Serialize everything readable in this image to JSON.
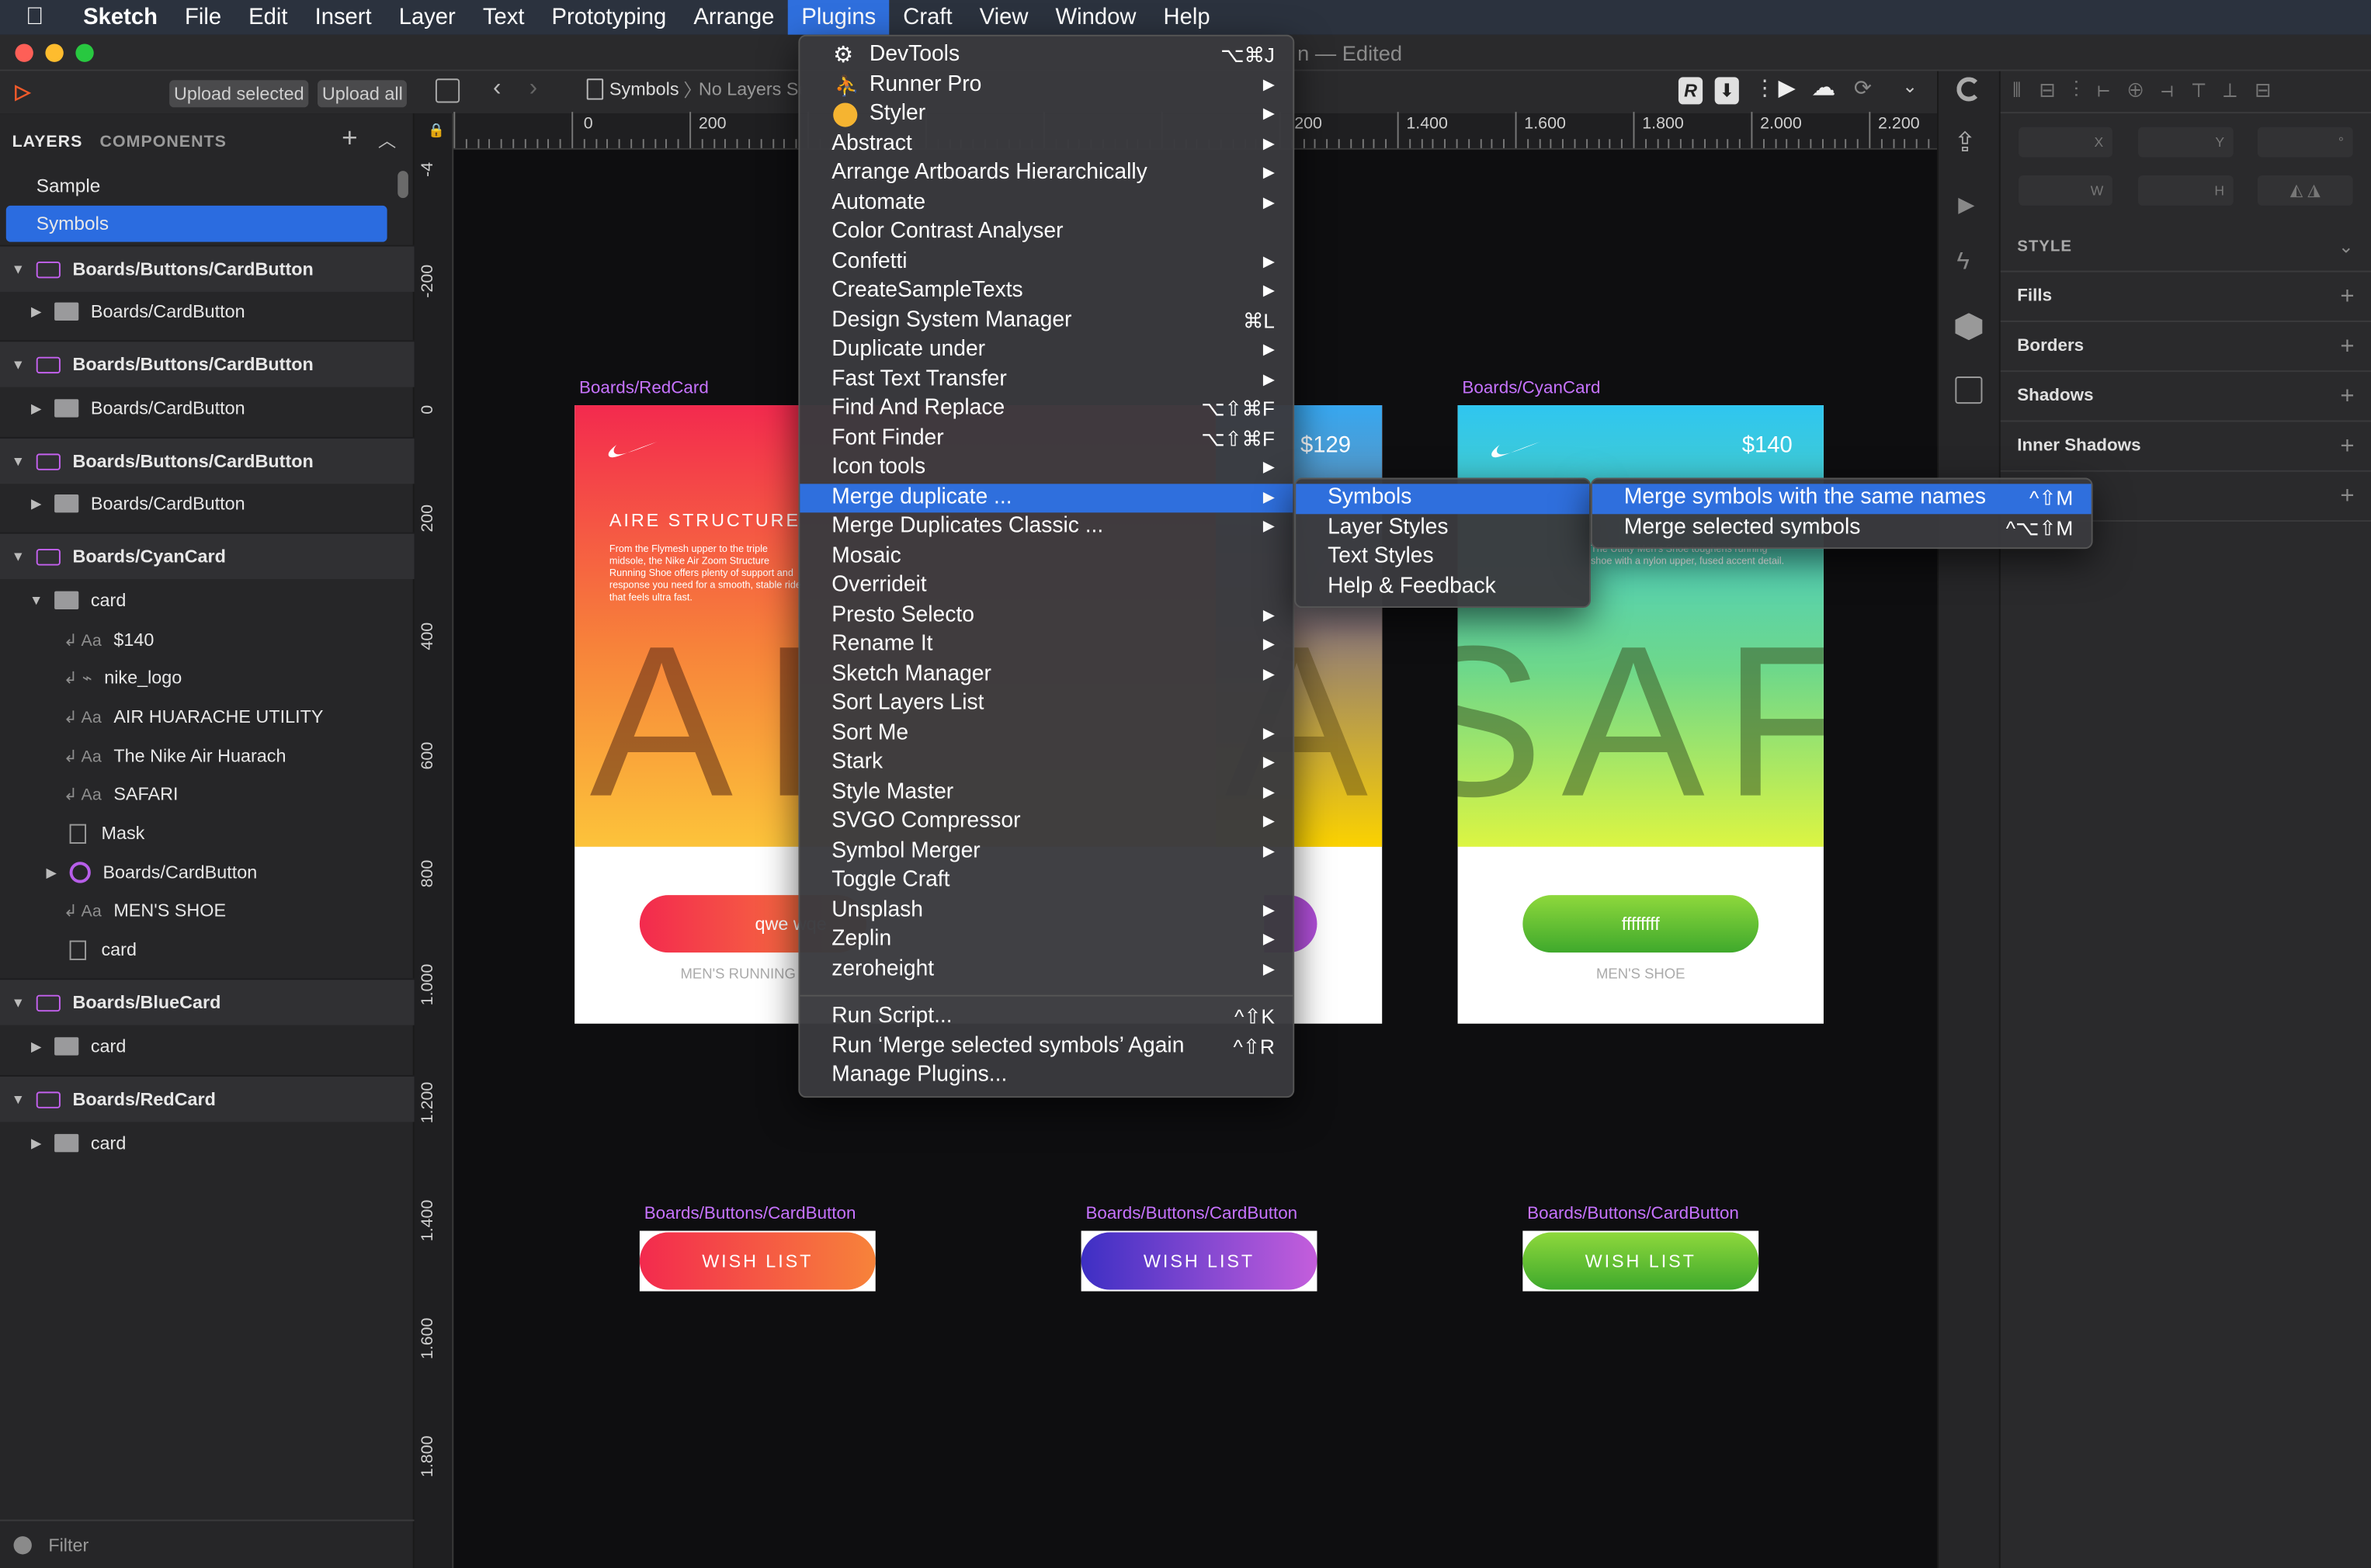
{
  "menubar": {
    "items": [
      "Sketch",
      "File",
      "Edit",
      "Insert",
      "Layer",
      "Text",
      "Prototyping",
      "Arrange",
      "Plugins",
      "Craft",
      "View",
      "Window",
      "Help"
    ],
    "active": "Plugins"
  },
  "window": {
    "title_suffix": "n — Edited"
  },
  "toolbar": {
    "upload_selected": "Upload selected",
    "upload_all": "Upload all",
    "breadcrumb_page": "Symbols",
    "breadcrumb_layers": "No Layers Se"
  },
  "left_panel": {
    "tab_layers": "LAYERS",
    "tab_components": "COMPONENTS",
    "pages": [
      "Sample",
      "Symbols"
    ],
    "layers": [
      {
        "label": "Boards/Buttons/CardButton",
        "kind": "board"
      },
      {
        "label": "Boards/CardButton",
        "kind": "folder"
      },
      {
        "label": "Boards/Buttons/CardButton",
        "kind": "board"
      },
      {
        "label": "Boards/CardButton",
        "kind": "folder"
      },
      {
        "label": "Boards/Buttons/CardButton",
        "kind": "board"
      },
      {
        "label": "Boards/CardButton",
        "kind": "folder"
      },
      {
        "label": "Boards/CyanCard",
        "kind": "board"
      },
      {
        "label": "card",
        "kind": "folder-open"
      },
      {
        "label": "$140",
        "kind": "text"
      },
      {
        "label": "nike_logo",
        "kind": "shape"
      },
      {
        "label": "AIR HUARACHE UTILITY",
        "kind": "text"
      },
      {
        "label": "The Nike Air Huarach",
        "kind": "text"
      },
      {
        "label": "SAFARI",
        "kind": "text"
      },
      {
        "label": "Mask",
        "kind": "rect"
      },
      {
        "label": "Boards/CardButton",
        "kind": "symbol"
      },
      {
        "label": "MEN'S SHOE",
        "kind": "text"
      },
      {
        "label": "card",
        "kind": "rect"
      },
      {
        "label": "Boards/BlueCard",
        "kind": "board"
      },
      {
        "label": "card",
        "kind": "folder"
      },
      {
        "label": "Boards/RedCard",
        "kind": "board"
      },
      {
        "label": "card",
        "kind": "folder"
      }
    ],
    "filter": "Filter"
  },
  "rulers": {
    "h_labels": [
      "0",
      "200",
      "200",
      "1.400",
      "1.600",
      "1.800",
      "2.000",
      "2.200"
    ],
    "v_labels": [
      "-4",
      "-200",
      "0",
      "200",
      "400",
      "600",
      "800",
      "1.000",
      "1.200",
      "1.400",
      "1.600",
      "1.800"
    ]
  },
  "canvas": {
    "red_card": {
      "label": "Boards/RedCard",
      "title": "AIRE STRUCTURE",
      "body": "From the Flymesh upper to the triple midsole, the Nike Air Zoom Structure Running Shoe offers plenty of support and response you need for a smooth, stable ride that feels ultra fast.",
      "big": "AI",
      "button": "qwe wqe",
      "footer": "MEN'S RUNNING"
    },
    "blue_card": {
      "price": "$129",
      "big": "A"
    },
    "cyan_card": {
      "label": "Boards/CyanCard",
      "price": "$140",
      "body": "The Utility Men's Shoe toughens running shoe with a nylon upper, fused accent detail.",
      "big": "SAF",
      "button": "ffffffff",
      "footer": "MEN'S SHOE"
    },
    "wish_buttons": [
      {
        "label": "Boards/Buttons/CardButton",
        "text": "WISH LIST"
      },
      {
        "label": "Boards/Buttons/CardButton",
        "text": "WISH LIST"
      },
      {
        "label": "Boards/Buttons/CardButton",
        "text": "WISH LIST"
      }
    ]
  },
  "inspector": {
    "fields": [
      "X",
      "Y",
      "°",
      "W",
      "H"
    ],
    "style": "STYLE",
    "sections": [
      "Fills",
      "Borders",
      "Shadows",
      "Inner Shadows"
    ]
  },
  "plugins_menu": {
    "items": [
      {
        "label": "DevTools",
        "shortcut": "⌥⌘J",
        "icon": "gear-icon"
      },
      {
        "label": "Runner Pro",
        "submenu": true,
        "icon": "runner-icon"
      },
      {
        "label": "Styler",
        "submenu": true,
        "icon": "styler-icon"
      },
      {
        "label": "Abstract",
        "submenu": true
      },
      {
        "label": "Arrange Artboards Hierarchically",
        "submenu": true
      },
      {
        "label": "Automate",
        "submenu": true
      },
      {
        "label": "Color Contrast Analyser"
      },
      {
        "label": "Confetti",
        "submenu": true
      },
      {
        "label": "CreateSampleTexts",
        "submenu": true
      },
      {
        "label": "Design System Manager",
        "shortcut": "⌘L"
      },
      {
        "label": "Duplicate under",
        "submenu": true
      },
      {
        "label": "Fast Text Transfer",
        "submenu": true
      },
      {
        "label": "Find And Replace",
        "shortcut": "⌥⇧⌘F"
      },
      {
        "label": "Font Finder",
        "shortcut": "⌥⇧⌘F"
      },
      {
        "label": "Icon tools",
        "submenu": true
      },
      {
        "label": "Merge duplicate ...",
        "submenu": true,
        "highlighted": true
      },
      {
        "label": "Merge Duplicates Classic ...",
        "submenu": true
      },
      {
        "label": "Mosaic"
      },
      {
        "label": "Overrideit"
      },
      {
        "label": "Presto Selecto",
        "submenu": true
      },
      {
        "label": "Rename It",
        "submenu": true
      },
      {
        "label": "Sketch Manager",
        "submenu": true
      },
      {
        "label": "Sort Layers List"
      },
      {
        "label": "Sort Me",
        "submenu": true
      },
      {
        "label": "Stark",
        "submenu": true
      },
      {
        "label": "Style Master",
        "submenu": true
      },
      {
        "label": "SVGO Compressor",
        "submenu": true
      },
      {
        "label": "Symbol Merger",
        "submenu": true
      },
      {
        "label": "Toggle Craft"
      },
      {
        "label": "Unsplash",
        "submenu": true
      },
      {
        "label": "Zeplin",
        "submenu": true
      },
      {
        "label": "zeroheight",
        "submenu": true
      }
    ],
    "footer": [
      {
        "label": "Run Script...",
        "shortcut": "^⇧K"
      },
      {
        "label": "Run ‘Merge selected symbols’ Again",
        "shortcut": "^⇧R"
      },
      {
        "label": "Manage Plugins..."
      }
    ]
  },
  "merge_submenu": {
    "items": [
      {
        "label": "Symbols",
        "highlighted": true
      },
      {
        "label": "Layer Styles"
      },
      {
        "label": "Text Styles"
      },
      {
        "label": "Help & Feedback"
      }
    ]
  },
  "symbols_submenu": {
    "items": [
      {
        "label": "Merge symbols with the same names",
        "shortcut": "^⇧M",
        "highlighted": true
      },
      {
        "label": "Merge selected symbols",
        "shortcut": "^⌥⇧M"
      }
    ]
  }
}
